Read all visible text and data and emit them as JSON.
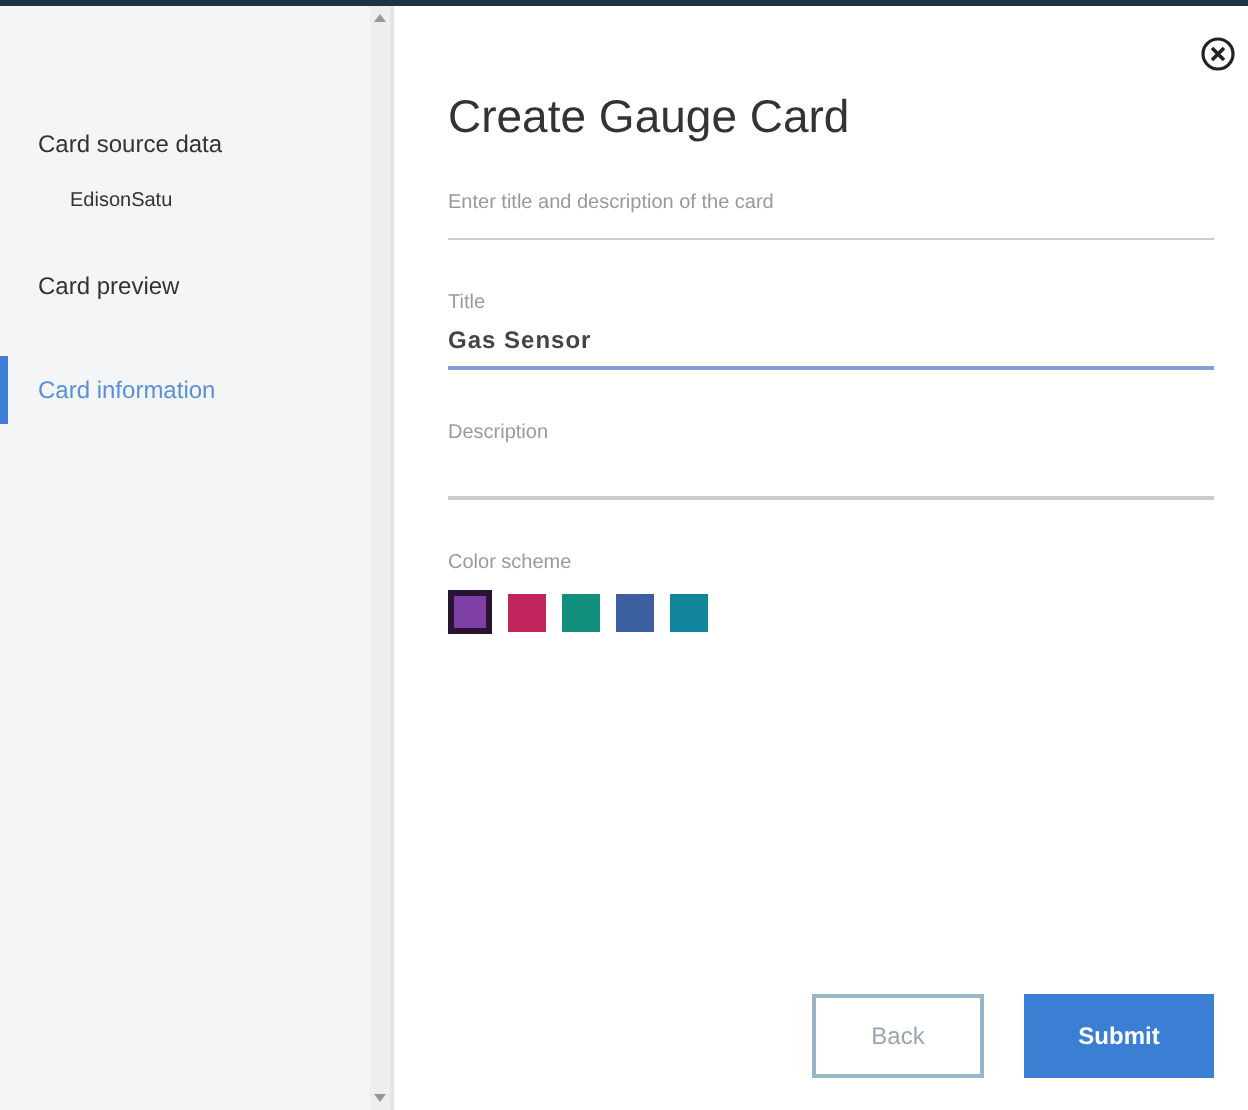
{
  "sidebar": {
    "items": [
      {
        "label": "Card source data",
        "selected": false,
        "children": [
          {
            "label": "EdisonSatu"
          }
        ]
      },
      {
        "label": "Card preview",
        "selected": false
      },
      {
        "label": "Card information",
        "selected": true
      }
    ]
  },
  "dialog": {
    "title": "Create Gauge Card",
    "subtitle": "Enter title and description of the card",
    "fields": [
      {
        "label": "Title",
        "value": "Gas Sensor",
        "focused": true
      },
      {
        "label": "Description",
        "focused": false
      }
    ],
    "color_scheme": {
      "label": "Color scheme",
      "swatches": [
        {
          "color": "#7e3fa6",
          "selected": true
        },
        {
          "color": "#c2255e",
          "selected": false
        },
        {
          "color": "#138f7e",
          "selected": false
        },
        {
          "color": "#3b5f9f",
          "selected": false
        },
        {
          "color": "#11869c",
          "selected": false
        }
      ]
    },
    "buttons": [
      {
        "label": "Back",
        "kind": "secondary"
      },
      {
        "label": "Submit",
        "kind": "primary"
      }
    ]
  }
}
